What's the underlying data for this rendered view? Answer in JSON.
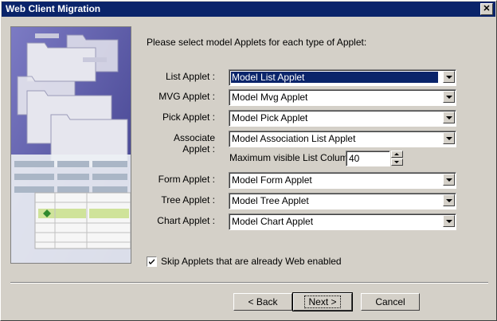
{
  "window": {
    "title": "Web Client Migration"
  },
  "instructions": "Please select model Applets for each type of Applet:",
  "applets": [
    {
      "label": "List Applet :",
      "value": "Model List Applet",
      "selected": true
    },
    {
      "label": "MVG Applet :",
      "value": "Model Mvg Applet"
    },
    {
      "label": "Pick Applet :",
      "value": "Model Pick Applet"
    },
    {
      "label": "Associate Applet :",
      "value": "Model Association List Applet"
    },
    {
      "label": "Form Applet :",
      "value": "Model Form Applet"
    },
    {
      "label": "Tree Applet :",
      "value": "Model Tree Applet"
    },
    {
      "label": "Chart Applet :",
      "value": "Model Chart Applet"
    }
  ],
  "max_columns": {
    "label": "Maximum visible List Columns",
    "value": "40"
  },
  "skip_checkbox": {
    "label": "Skip Applets that are already Web enabled",
    "checked": true
  },
  "buttons": {
    "back": "< Back",
    "next": "Next >",
    "cancel": "Cancel"
  },
  "colors": {
    "titlebar": "#0a246a",
    "dialog": "#d4d0c8",
    "art_bg": "#5b5aa8"
  }
}
